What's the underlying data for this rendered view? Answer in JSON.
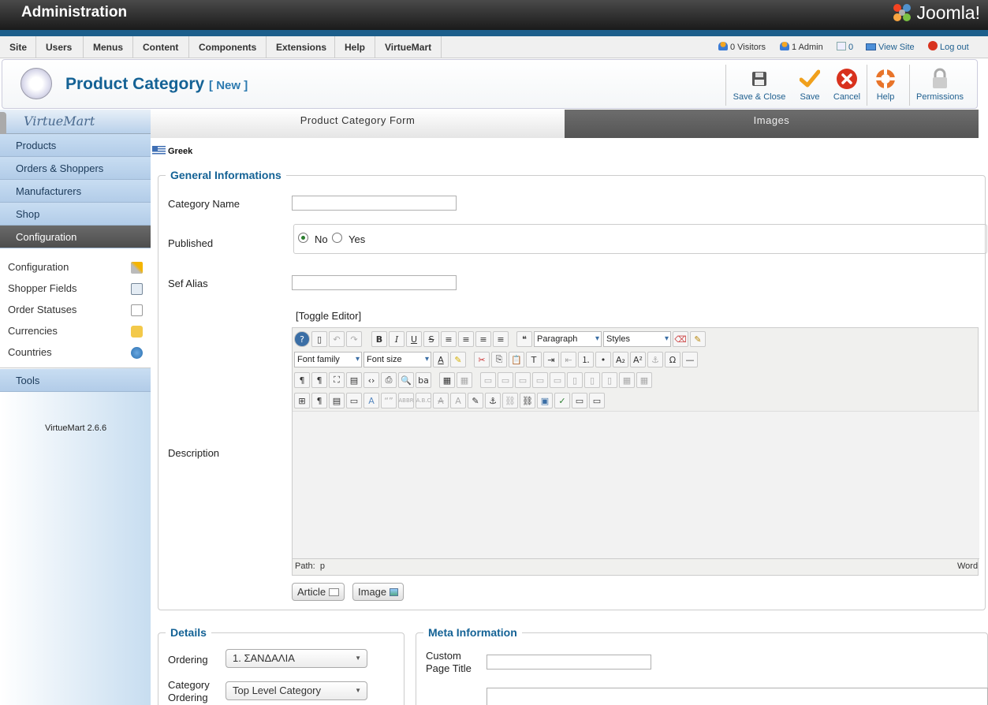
{
  "header": {
    "title": "Administration",
    "logo_text": "Joomla!"
  },
  "menu": {
    "items": [
      "Site",
      "Users",
      "Menus",
      "Content",
      "Components",
      "Extensions",
      "Help",
      "VirtueMart"
    ],
    "status": {
      "visitors": "0 Visitors",
      "admins": "1 Admin",
      "messages": "0",
      "view_site": "View Site",
      "logout": "Log out"
    }
  },
  "toolbar": {
    "page_title": "Product Category",
    "page_subtitle": "[ New ]",
    "buttons": {
      "save_close": "Save & Close",
      "save": "Save",
      "cancel": "Cancel",
      "help": "Help",
      "permissions": "Permissions"
    }
  },
  "sidebar": {
    "logo": "VirtueMart",
    "items": [
      "Products",
      "Orders & Shoppers",
      "Manufacturers",
      "Shop",
      "Configuration"
    ],
    "submenu": [
      "Configuration",
      "Shopper Fields",
      "Order Statuses",
      "Currencies",
      "Countries"
    ],
    "tools": "Tools",
    "version": "VirtueMart 2.6.6"
  },
  "tabs": [
    "Product Category Form",
    "Images"
  ],
  "language": "Greek",
  "general": {
    "legend": "General Informations",
    "category_name_label": "Category Name",
    "category_name_value": "",
    "published_label": "Published",
    "published_no": "No",
    "published_yes": "Yes",
    "published_value": "No",
    "sef_alias_label": "Sef Alias",
    "sef_alias_value": "",
    "description_label": "Description",
    "toggle_editor": "[Toggle Editor]"
  },
  "editor": {
    "format_select": "Paragraph",
    "styles_select": "Styles",
    "font_family": "Font family",
    "font_size": "Font size",
    "path_label": "Path:",
    "path_value": "p",
    "words_label": "Words",
    "article_button": "Article",
    "image_button": "Image"
  },
  "details": {
    "legend": "Details",
    "ordering_label": "Ordering",
    "ordering_value": "1. ΣΑΝΔΑΛΙΑ",
    "category_ordering_label_1": "Category",
    "category_ordering_label_2": "Ordering",
    "category_ordering_value": "Top Level Category"
  },
  "meta": {
    "legend": "Meta Information",
    "custom_title_label_1": "Custom",
    "custom_title_label_2": "Page Title",
    "custom_title_value": ""
  }
}
